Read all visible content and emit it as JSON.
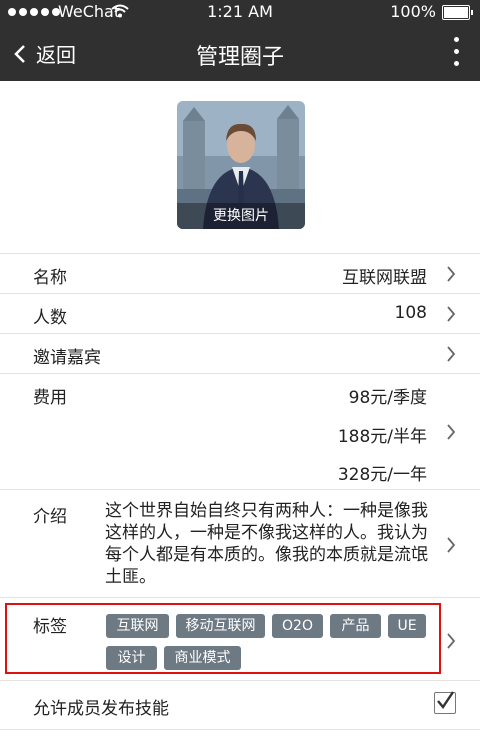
{
  "status": {
    "carrier": "WeChat",
    "time": "1:21 AM",
    "battery": "100%"
  },
  "nav": {
    "back_label": "返回",
    "title": "管理圈子"
  },
  "avatar": {
    "caption": "更换图片"
  },
  "rows": {
    "name": {
      "label": "名称",
      "value": "互联网联盟"
    },
    "count": {
      "label": "人数",
      "value": "108"
    },
    "guests": {
      "label": "邀请嘉宾"
    },
    "fees": {
      "label": "费用",
      "items": [
        "98元/季度",
        "188元/半年",
        "328元/一年"
      ]
    },
    "intro": {
      "label": "介绍",
      "text": "这个世界自始自终只有两种人：一种是像我这样的人，一种是不像我这样的人。我认为每个人都是有本质的。像我的本质就是流氓土匪。"
    },
    "tags": {
      "label": "标签",
      "items": [
        "互联网",
        "移动互联网",
        "O2O",
        "产品",
        "UE",
        "设计",
        "商业模式"
      ]
    },
    "allow": {
      "label": "允许成员发布技能",
      "checked": true
    }
  },
  "colors": {
    "bar": "#303030",
    "tag": "#6d7a84",
    "highlight": "#dd1111"
  }
}
